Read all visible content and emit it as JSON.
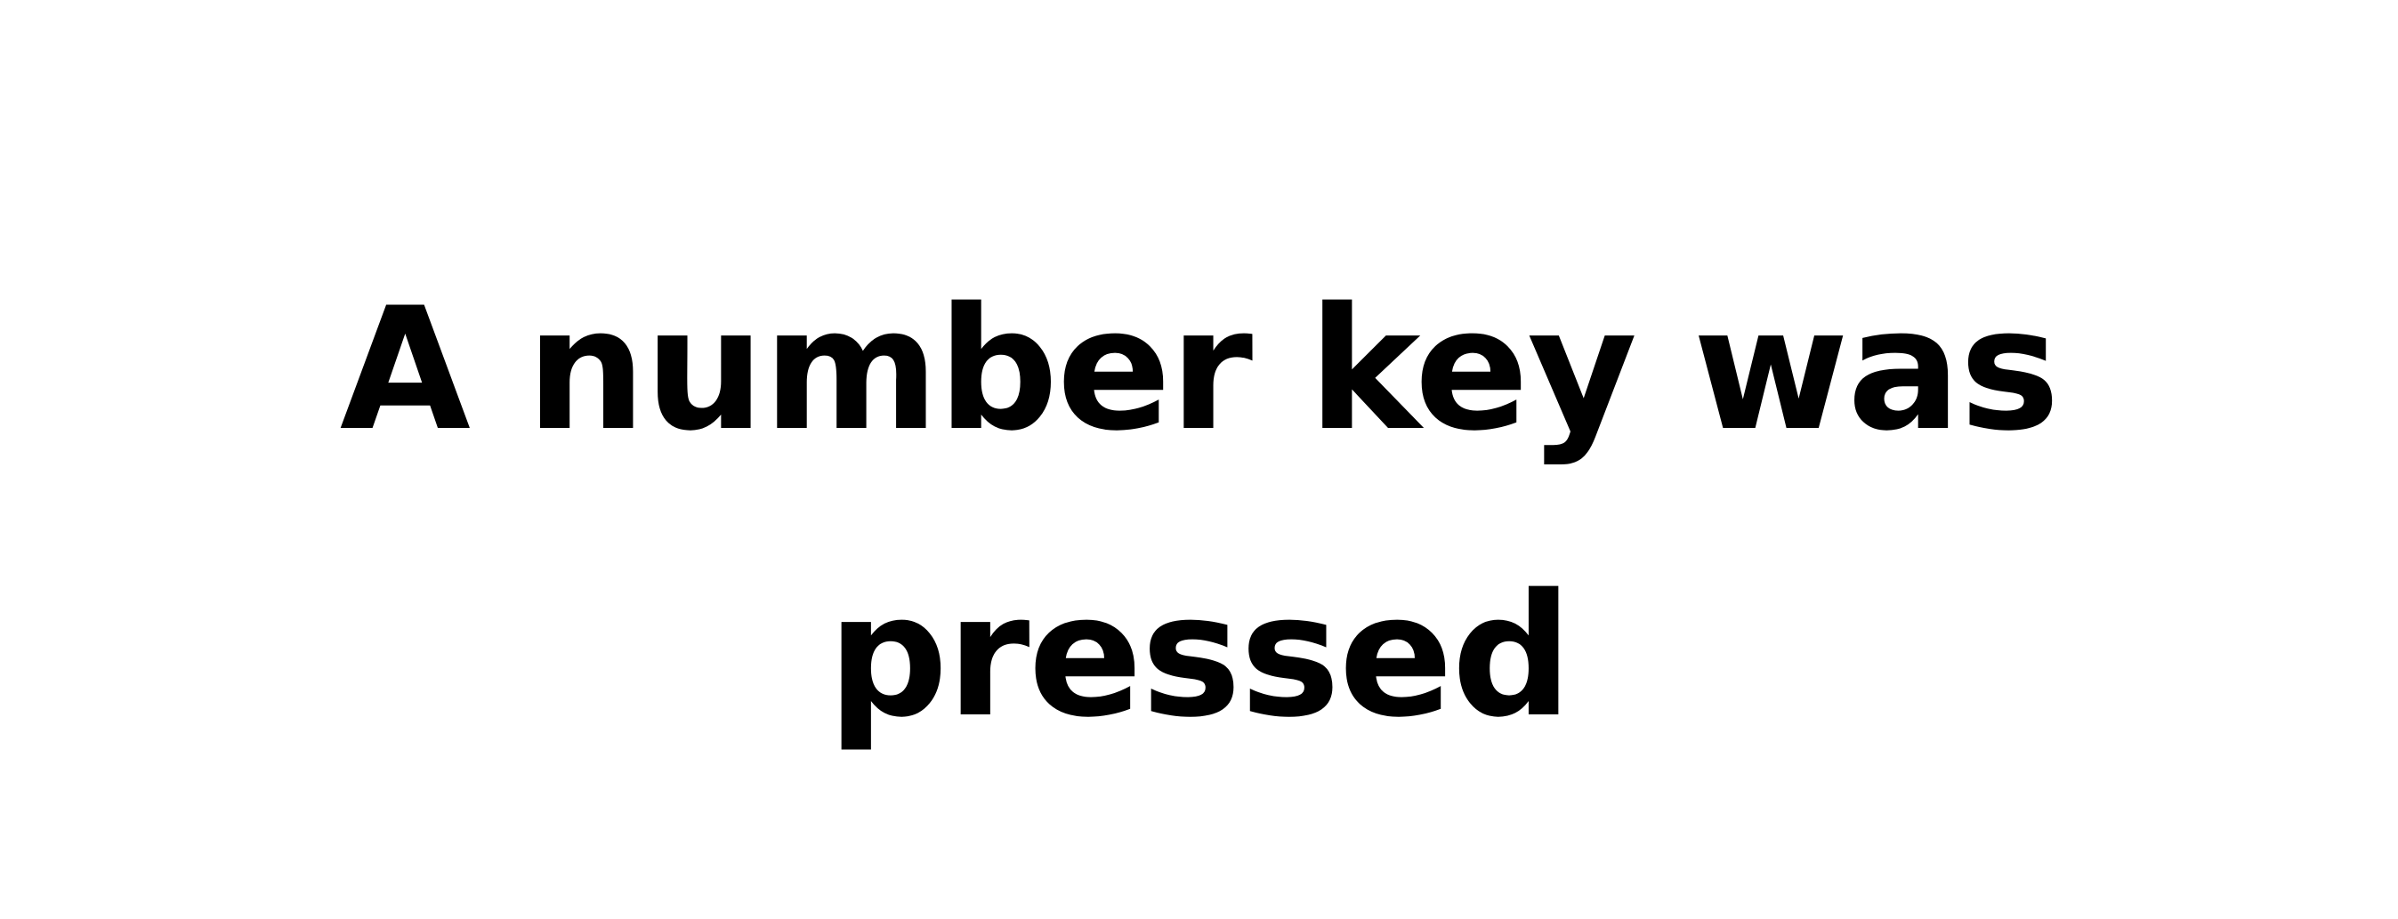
{
  "message": {
    "text": "A number key was pressed",
    "text_color": "#000000",
    "background_color": "#ffffff"
  }
}
